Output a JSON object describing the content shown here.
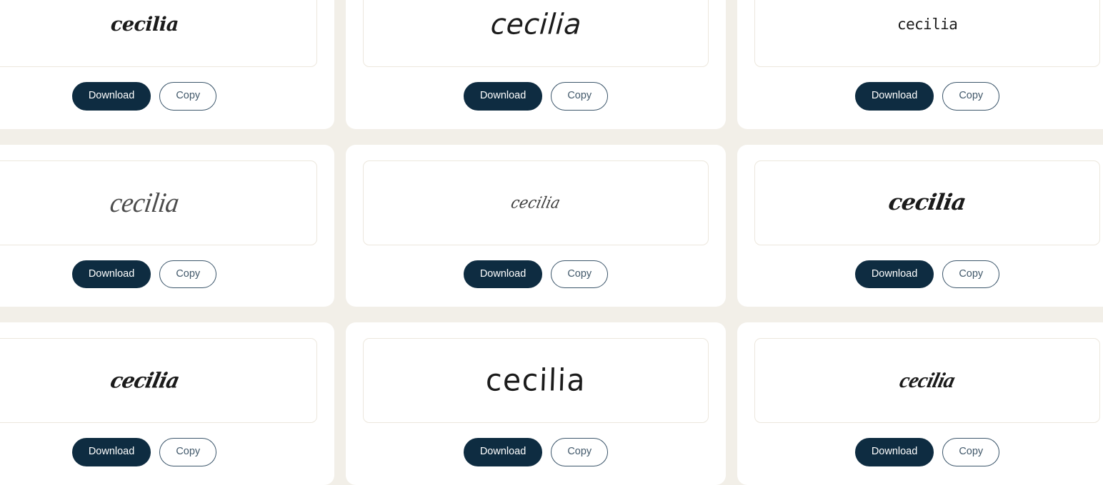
{
  "theme": {
    "page_background": "#f2efe8",
    "card_background": "#ffffff",
    "preview_border": "#ece7dd",
    "download_bg": "#0e2c41",
    "download_text": "#ffffff",
    "copy_border": "#3c566b",
    "copy_text": "#41586a"
  },
  "actions": {
    "download_label": "Download",
    "copy_label": "Copy"
  },
  "grid": {
    "columns": 3,
    "rows": 3,
    "cards": [
      {
        "preview_text": "cecilia",
        "style_key": "s-serif-bold-italic",
        "download_label": "Download",
        "copy_label": "Copy"
      },
      {
        "preview_text": "cecilia",
        "style_key": "s-marker",
        "download_label": "Download",
        "copy_label": "Copy"
      },
      {
        "preview_text": "cecilia",
        "style_key": "s-mono-light",
        "download_label": "Download",
        "copy_label": "Copy"
      },
      {
        "preview_text": "cecilia",
        "style_key": "s-thin-script",
        "download_label": "Download",
        "copy_label": "Copy"
      },
      {
        "preview_text": "cecilia",
        "style_key": "s-calligraphy-small",
        "download_label": "Download",
        "copy_label": "Copy"
      },
      {
        "preview_text": "cecilia",
        "style_key": "s-serif-script-bold",
        "download_label": "Download",
        "copy_label": "Copy"
      },
      {
        "preview_text": "cecilia",
        "style_key": "s-brush-bold",
        "download_label": "Download",
        "copy_label": "Copy"
      },
      {
        "preview_text": "cecilia",
        "style_key": "s-hand-light-large",
        "download_label": "Download",
        "copy_label": "Copy"
      },
      {
        "preview_text": "cecilia",
        "style_key": "s-script-medium",
        "download_label": "Download",
        "copy_label": "Copy"
      }
    ]
  }
}
